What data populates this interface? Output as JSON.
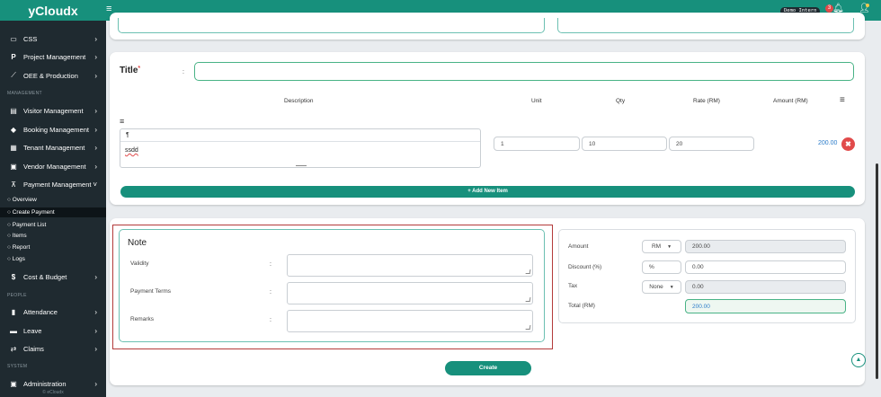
{
  "brand": "yCloudx",
  "sidebar": {
    "items": [
      {
        "label": "CSS",
        "icon": "monitor-icon",
        "glyph": "▭"
      },
      {
        "label": "Project Management",
        "icon": "project-icon",
        "glyph": "P"
      },
      {
        "label": "OEE & Production",
        "icon": "chart-line-icon",
        "glyph": "⟋"
      },
      {
        "section": "MANAGEMENT"
      },
      {
        "label": "Visitor Management",
        "icon": "id-card-icon",
        "glyph": "▤"
      },
      {
        "label": "Booking Management",
        "icon": "tag-icon",
        "glyph": "◆"
      },
      {
        "label": "Tenant Management",
        "icon": "building-icon",
        "glyph": "▦"
      },
      {
        "label": "Vendor Management",
        "icon": "vendor-card-icon",
        "glyph": "▣"
      },
      {
        "label": "Payment Management",
        "icon": "cart-icon",
        "glyph": "⊼"
      }
    ],
    "payment_sub": [
      "Overview",
      "Create Payment",
      "Payment List",
      "Items",
      "Report",
      "Logs"
    ],
    "cost_budget": "Cost & Budget",
    "section_people": "PEOPLE",
    "attendance": "Attendance",
    "leave": "Leave",
    "claims": "Claims",
    "section_system": "SYSTEM",
    "administration": "Administration",
    "copyright": "© eCloudx"
  },
  "topbar": {
    "demo_badge": "Demo Intern",
    "notification_count": "3"
  },
  "title_label": "Title",
  "title_required": "*",
  "title_colon": ":",
  "table": {
    "headers": {
      "description": "Description",
      "unit": "Unit",
      "qty": "Qty",
      "rate": "Rate (RM)",
      "amount": "Amount (RM)"
    },
    "row": {
      "description": "ssdd",
      "unit": "1",
      "qty": "10",
      "rate": "20",
      "amount": "200.00"
    },
    "editor_toolbar": "¶",
    "add_item": "+ Add New Item"
  },
  "note": {
    "title": "Note",
    "fields": [
      "Validity",
      "Payment Terms",
      "Remarks"
    ],
    "colon": ":"
  },
  "summary": {
    "amount_label": "Amount",
    "amount_currency": "RM",
    "amount_value": "200.00",
    "discount_label": "Discount (%)",
    "discount_unit": "%",
    "discount_value": "0.00",
    "tax_label": "Tax",
    "tax_option": "None",
    "tax_value": "0.00",
    "total_label": "Total (RM)",
    "total_value": "200.00"
  },
  "create_button": "Create",
  "colors": {
    "teal": "#17907c",
    "sidebar_bg": "#1f2a30",
    "danger": "#e14a4a",
    "highlight_border": "#b33a3a",
    "amount_text": "#2a7bc9"
  }
}
